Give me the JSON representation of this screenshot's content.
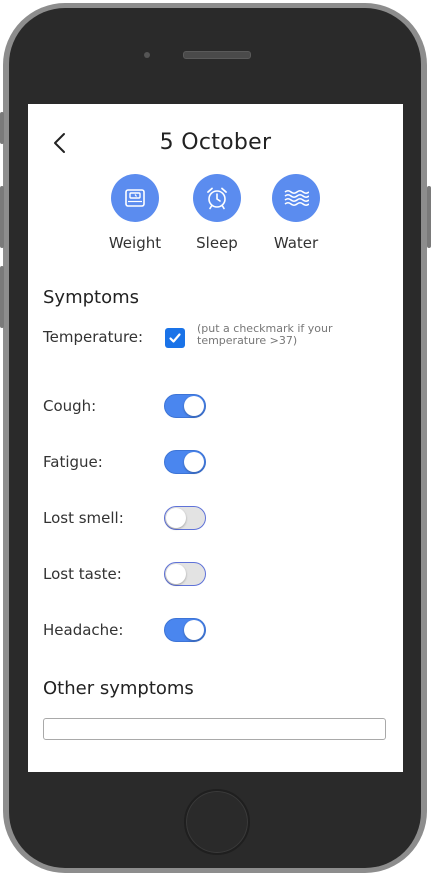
{
  "header": {
    "back_icon": "chevron-left-icon",
    "date_title": "5 October"
  },
  "metrics": [
    {
      "label": "Weight",
      "icon": "scale-icon"
    },
    {
      "label": "Sleep",
      "icon": "alarm-clock-icon"
    },
    {
      "label": "Water",
      "icon": "waves-icon"
    }
  ],
  "accent_color": "#5b8cef",
  "symptoms": {
    "title": "Symptoms",
    "temperature": {
      "label": "Temperature:",
      "checked": true,
      "hint": "(put a checkmark if your temperature >37)"
    },
    "toggles": [
      {
        "label": "Cough:",
        "on": true
      },
      {
        "label": "Fatigue:",
        "on": true
      },
      {
        "label": "Lost smell:",
        "on": false
      },
      {
        "label": "Lost taste:",
        "on": false
      },
      {
        "label": "Headache:",
        "on": true
      }
    ]
  },
  "other_symptoms": {
    "title": "Other symptoms",
    "value": "",
    "placeholder": ""
  }
}
